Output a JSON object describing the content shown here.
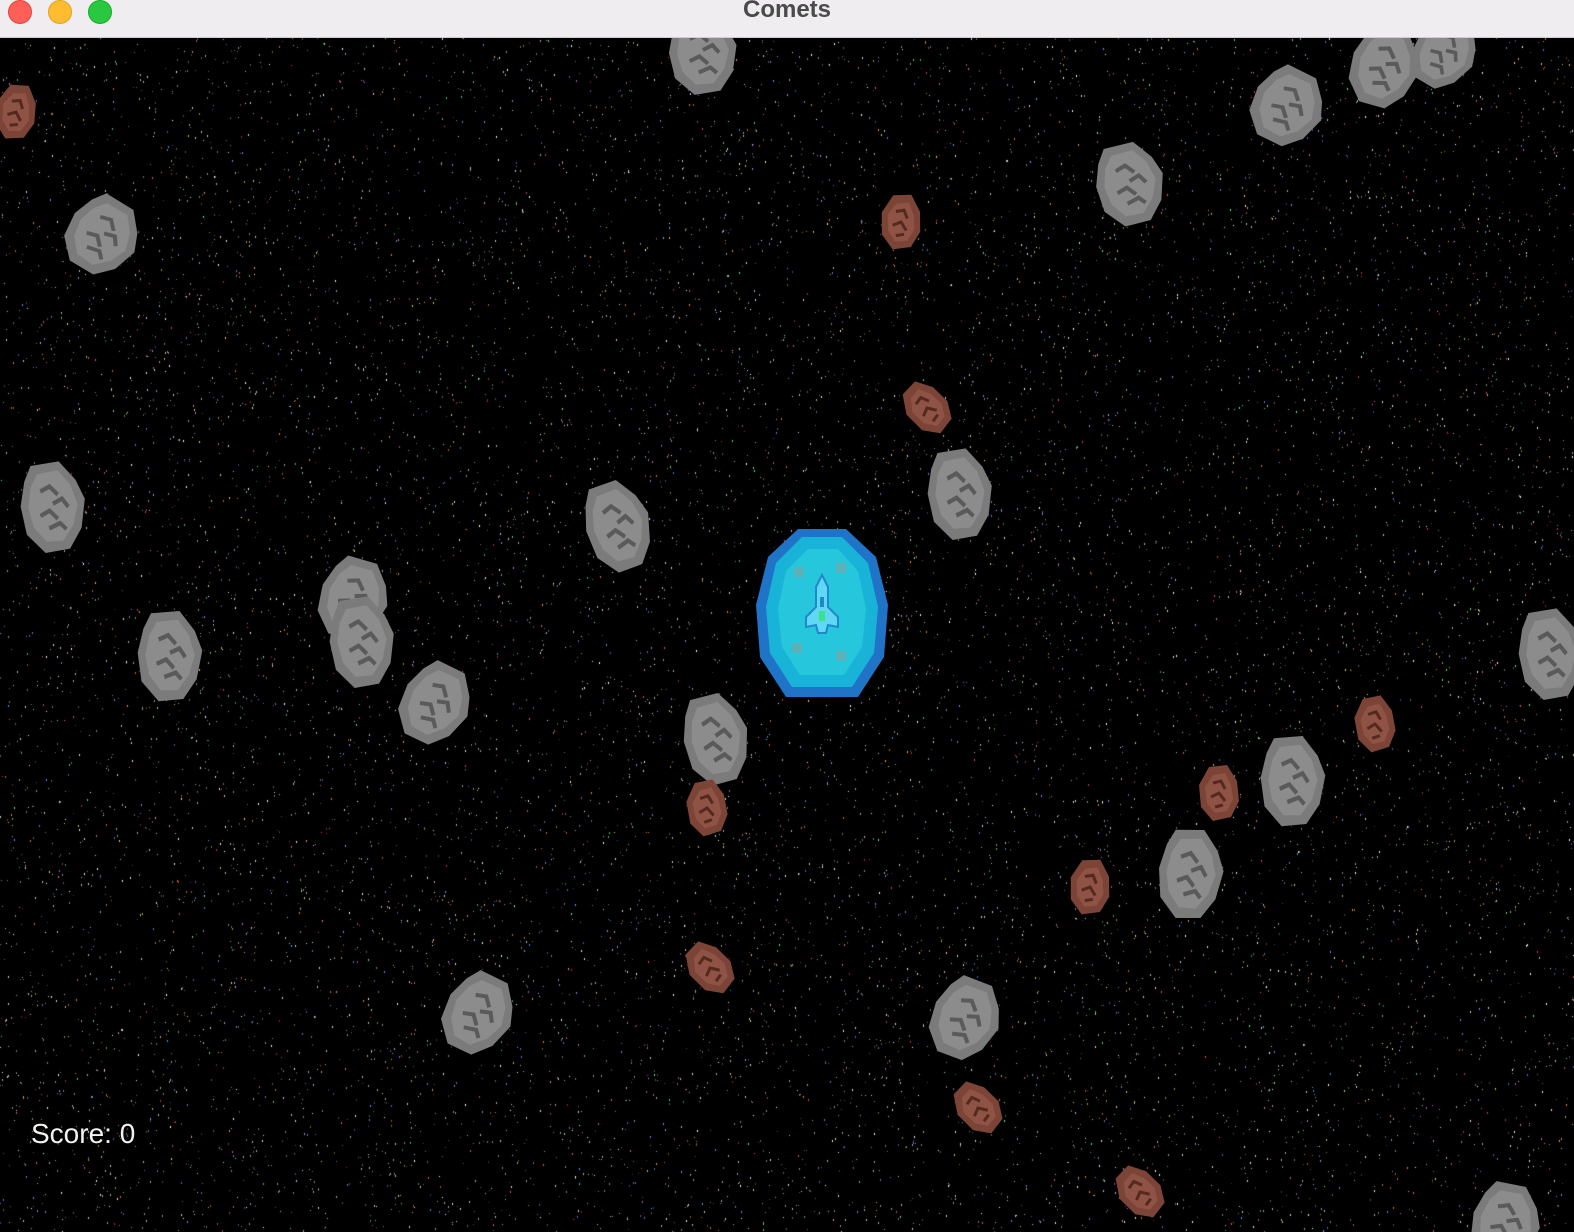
{
  "window": {
    "title": "Comets",
    "controls": [
      "close",
      "minimize",
      "zoom"
    ]
  },
  "hud": {
    "score_text": "Score: 0"
  },
  "scene": {
    "background": "#000000",
    "starfield": true,
    "player": {
      "sprite": "ship-icon",
      "shield": "active",
      "shield_color": "#29b6e8"
    },
    "asteroid_colors": {
      "gray": "#7d7d7d",
      "brown": "#8a4a3c"
    }
  }
}
